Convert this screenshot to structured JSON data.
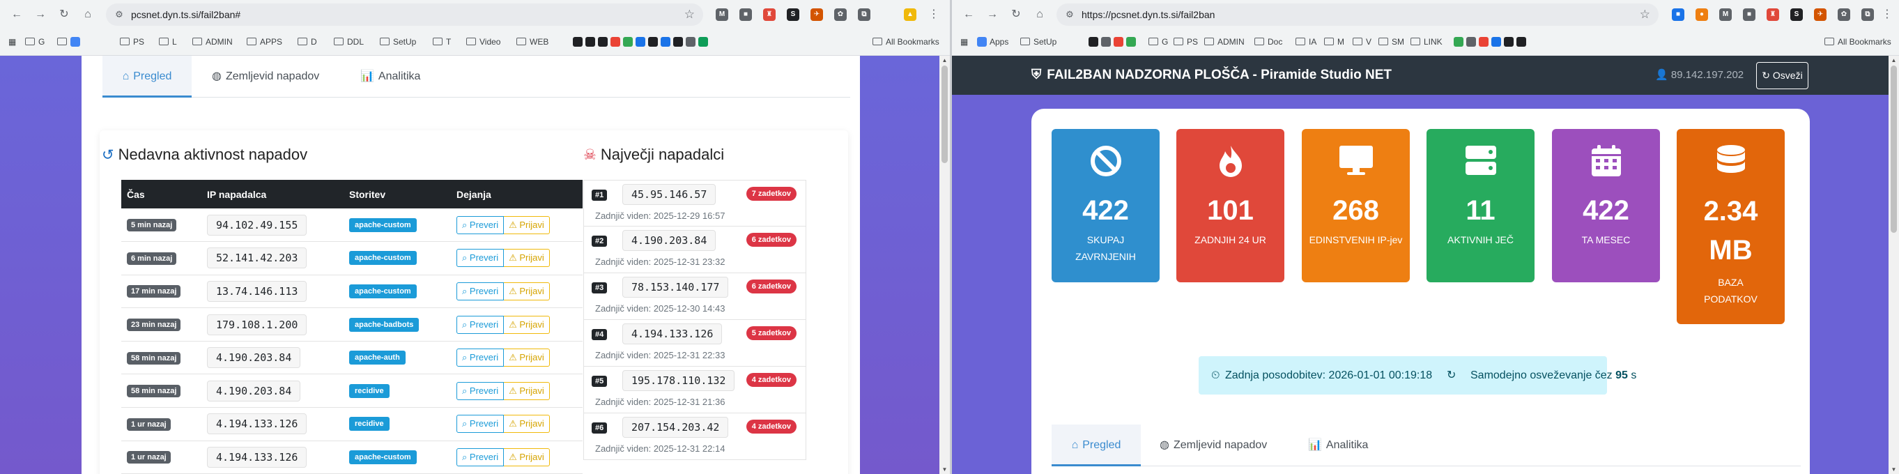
{
  "left_window": {
    "nav": {
      "back": "←",
      "forward": "→",
      "reload": "↻",
      "home": "⌂"
    },
    "url": "pcsnet.dyn.ts.si/fail2ban#",
    "bookmarks": [
      {
        "label": "G"
      },
      {
        "label": ""
      },
      {
        "label": "PS"
      },
      {
        "label": "L"
      },
      {
        "label": "ADMIN"
      },
      {
        "label": "APPS"
      },
      {
        "label": "D"
      },
      {
        "label": "DDL"
      },
      {
        "label": "SetUp"
      },
      {
        "label": "T"
      },
      {
        "label": "Video"
      },
      {
        "label": "WEB"
      }
    ],
    "all_bookmarks": "All Bookmarks",
    "tabs": [
      {
        "icon": "home-icon",
        "glyph": "⌂",
        "label": "Pregled"
      },
      {
        "icon": "globe-icon",
        "glyph": "◍",
        "label": "Zemljevid napadov"
      },
      {
        "icon": "chart-icon",
        "glyph": "📊",
        "label": "Analitika"
      }
    ],
    "recent": {
      "title": "Nedavna aktivnost napadov",
      "icon_glyph": "↺",
      "headers": [
        "Čas",
        "IP napadalca",
        "Storitev",
        "Dejanja"
      ],
      "rows": [
        {
          "time": "5 min nazaj",
          "ip": "94.102.49.155",
          "service": "apache-custom"
        },
        {
          "time": "6 min nazaj",
          "ip": "52.141.42.203",
          "service": "apache-custom"
        },
        {
          "time": "17 min nazaj",
          "ip": "13.74.146.113",
          "service": "apache-custom"
        },
        {
          "time": "23 min nazaj",
          "ip": "179.108.1.200",
          "service": "apache-badbots"
        },
        {
          "time": "58 min nazaj",
          "ip": "4.190.203.84",
          "service": "apache-auth"
        },
        {
          "time": "58 min nazaj",
          "ip": "4.190.203.84",
          "service": "recidive"
        },
        {
          "time": "1 ur nazaj",
          "ip": "4.194.133.126",
          "service": "recidive"
        },
        {
          "time": "1 ur nazaj",
          "ip": "4.194.133.126",
          "service": "apache-custom"
        }
      ],
      "btn_check": "Preveri",
      "btn_report": "Prijavi"
    },
    "top": {
      "title": "Največji napadalci",
      "icon_glyph": "☠",
      "items": [
        {
          "rank": "#1",
          "ip": "45.95.146.57",
          "count": "7 zadetkov",
          "seen": "Zadnjič viden: 2025-12-29 16:57"
        },
        {
          "rank": "#2",
          "ip": "4.190.203.84",
          "count": "6 zadetkov",
          "seen": "Zadnjič viden: 2025-12-31 23:32"
        },
        {
          "rank": "#3",
          "ip": "78.153.140.177",
          "count": "6 zadetkov",
          "seen": "Zadnjič viden: 2025-12-30 14:43"
        },
        {
          "rank": "#4",
          "ip": "4.194.133.126",
          "count": "5 zadetkov",
          "seen": "Zadnjič viden: 2025-12-31 22:33"
        },
        {
          "rank": "#5",
          "ip": "195.178.110.132",
          "count": "4 zadetkov",
          "seen": "Zadnjič viden: 2025-12-31 21:36"
        },
        {
          "rank": "#6",
          "ip": "207.154.203.42",
          "count": "4 zadetkov",
          "seen": "Zadnjič viden: 2025-12-31 22:14"
        }
      ]
    }
  },
  "right_window": {
    "nav": {
      "back": "←",
      "forward": "→",
      "reload": "↻",
      "home": "⌂"
    },
    "url": "https://pcsnet.dyn.ts.si/fail2ban",
    "bookmarks": [
      {
        "label": "Apps"
      },
      {
        "label": "SetUp"
      },
      {
        "label": "G"
      },
      {
        "label": "PS"
      },
      {
        "label": "ADMIN"
      },
      {
        "label": "Doc"
      },
      {
        "label": "IA"
      },
      {
        "label": "M"
      },
      {
        "label": "V"
      },
      {
        "label": "SM"
      },
      {
        "label": "LINK"
      }
    ],
    "all_bookmarks": "All Bookmarks",
    "navbar": {
      "title": "FAIL2BAN NADZORNA PLOŠČA - Piramide Studio NET",
      "ip": "89.142.197.202",
      "refresh": "Osveži"
    },
    "stats": [
      {
        "icon": "ban-icon",
        "value": "422",
        "label": "SKUPAJ ZAVRNJENIH",
        "color": "#2f8fce"
      },
      {
        "icon": "fire-icon",
        "value": "101",
        "label": "ZADNJIH 24 UR",
        "color": "#e0483a"
      },
      {
        "icon": "monitor-icon",
        "value": "268",
        "label": "EDINSTVENIH IP-jev",
        "color": "#ee7f12"
      },
      {
        "icon": "server-icon",
        "value": "11",
        "label": "AKTIVNIH JEČ",
        "color": "#27ab5e"
      },
      {
        "icon": "calendar-icon",
        "value": "422",
        "label": "TA MESEC",
        "color": "#9c4fbd"
      },
      {
        "icon": "database-icon",
        "value": "2.34 MB",
        "label": "BAZA PODATKOV",
        "color": "#e2660b"
      }
    ],
    "info": {
      "last_update": "Zadnja posodobitev: 2026-01-01 00:19:18",
      "auto_prefix": "Samodejno osveževanje čez",
      "auto_value": "95",
      "auto_suffix": "s"
    },
    "tabs": [
      {
        "icon": "home-icon",
        "glyph": "⌂",
        "label": "Pregled"
      },
      {
        "icon": "globe-icon",
        "glyph": "◍",
        "label": "Zemljevid napadov"
      },
      {
        "icon": "chart-icon",
        "glyph": "📊",
        "label": "Analitika"
      }
    ]
  }
}
